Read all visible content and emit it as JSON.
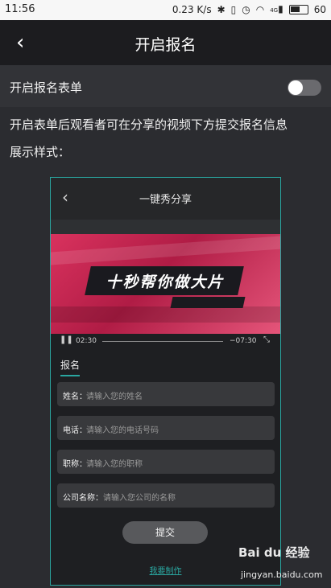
{
  "status_bar": {
    "time": "11:56",
    "speed": "0.23",
    "speed_unit": "K/s",
    "network": "4G",
    "battery": "60"
  },
  "header": {
    "back_icon": "‹",
    "title": "开启报名"
  },
  "toggle_row": {
    "label": "开启报名表单",
    "enabled": false
  },
  "description": "开启表单后观看者可在分享的视频下方提交报名信息",
  "sample_label": "展示样式：",
  "preview": {
    "title": "一键秀分享",
    "video_banner": "十秒帮你做大片",
    "current_time": "02:30",
    "remaining_time": "−07:30",
    "tab": "报名",
    "fields": [
      {
        "label": "姓名：",
        "placeholder": "请输入您的姓名"
      },
      {
        "label": "电话：",
        "placeholder": "请输入您的电话号码"
      },
      {
        "label": "职称：",
        "placeholder": "请输入您的职称"
      },
      {
        "label": "公司名称：",
        "placeholder": "请输入您公司的名称"
      }
    ],
    "submit_label": "提交",
    "make_link": "我要制作"
  },
  "watermark": {
    "logo": "Bai du 经验",
    "url": "jingyan.baidu.com"
  }
}
